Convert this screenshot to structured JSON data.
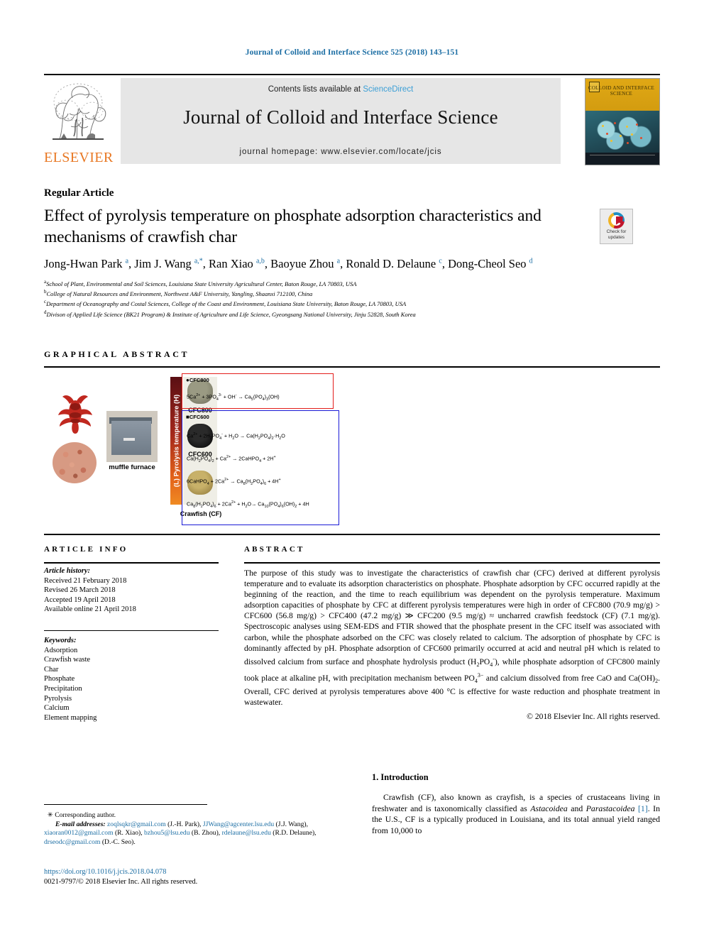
{
  "running_head": "Journal of Colloid and Interface Science 525 (2018) 143–151",
  "masthead": {
    "contents_prefix": "Contents lists available at ",
    "sciencedirect": "ScienceDirect",
    "journal_title": "Journal of Colloid and Interface Science",
    "homepage": "journal homepage: www.elsevier.com/locate/jcis",
    "publisher": "ELSEVIER",
    "cover_title": "COLLOID AND INTERFACE SCIENCE",
    "accent_blue": "#3c9fd6",
    "elsevier_orange": "#e87722"
  },
  "article": {
    "type": "Regular Article",
    "title": "Effect of pyrolysis temperature on phosphate adsorption characteristics and mechanisms of crawfish char",
    "crossmark_label": "Check for updates",
    "authors_html": "Jong-Hwan Park <sup>a</sup>, Jim J. Wang <sup>a,*</sup>, Ran Xiao <sup>a,b</sup>, Baoyue Zhou <sup>a</sup>, Ronald D. Delaune <sup>c</sup>, Dong-Cheol Seo <sup>d</sup>",
    "affiliations": [
      {
        "marker": "a",
        "text": "School of Plant, Environmental and Soil Sciences, Louisiana State University Agricultural Center, Baton Rouge, LA 70803, USA"
      },
      {
        "marker": "b",
        "text": "College of Natural Resources and Environment, Northwest A&F University, Yangling, Shaanxi 712100, China"
      },
      {
        "marker": "c",
        "text": "Department of Oceanography and Costal Sciences, College of the Coast and Environment, Louisiana State University, Baton Rouge, LA 70803, USA"
      },
      {
        "marker": "d",
        "text": "Divison of Applied Life Science (BK21 Program) & Institute of Agriculture and Life Science, Gyeongsang National University, Jinju 52828, South Korea"
      }
    ]
  },
  "graphical_abstract": {
    "heading": "GRAPHICAL ABSTRACT",
    "furnace_label": "muffle furnace",
    "temp_axis_label": "(L) Pyrolysis temperature (H)",
    "sample_labels": {
      "cfc800": "CFC800",
      "cfc600": "CFC600",
      "crawfish": "Crawfish (CF)"
    },
    "box_cfc800": {
      "header": "CFC800",
      "marker": "●",
      "border_color": "#e31d1a",
      "equations": [
        "5Ca<sup>2+</sup> + 3PO<sub>4</sub><sup>3-</sup> + OH<sup>-</sup> → Ca<sub>5</sub>(PO<sub>4</sub>)<sub>3</sub>(OH)"
      ]
    },
    "box_cfc600": {
      "header": "CFC600",
      "marker": "■",
      "border_color": "#1a1ad6",
      "equations": [
        "Ca<sup>2+</sup> + 2H<sub>2</sub>PO<sub>4</sub><sup>-</sup> + H<sub>2</sub>O → Ca(H<sub>2</sub>PO<sub>4</sub>)<sub>2</sub>·H<sub>2</sub>O",
        "Ca(H<sub>2</sub>PO<sub>4</sub>)<sub>2</sub> + Ca<sup>2+</sup> → 2CaHPO<sub>4</sub> + 2H<sup>+</sup>",
        "6CaHPO<sub>4</sub> + 2Ca<sup>2+</sup> → Ca<sub>8</sub>(H<sub>2</sub>PO<sub>4</sub>)<sub>6</sub> + 4H<sup>+</sup>",
        "Ca<sub>8</sub>(H<sub>2</sub>PO<sub>4</sub>)<sub>6</sub> + 2Ca<sup>2+</sup> + H<sub>2</sub>O→ Ca<sub>10</sub>(PO<sub>4</sub>)<sub>6</sub>(OH)<sub>2</sub> + 4H"
      ]
    }
  },
  "article_info": {
    "heading": "ARTICLE INFO",
    "history_label": "Article history:",
    "history": [
      "Received 21 February 2018",
      "Revised 26 March 2018",
      "Accepted 19 April 2018",
      "Available online 21 April 2018"
    ],
    "keywords_label": "Keywords:",
    "keywords": [
      "Adsorption",
      "Crawfish waste",
      "Char",
      "Phosphate",
      "Precipitation",
      "Pyrolysis",
      "Calcium",
      "Element mapping"
    ]
  },
  "abstract": {
    "heading": "ABSTRACT",
    "body_html": "The purpose of this study was to investigate the characteristics of crawfish char (CFC) derived at different pyrolysis temperature and to evaluate its adsorption characteristics on phosphate. Phosphate adsorption by CFC occurred rapidly at the beginning of the reaction, and the time to reach equilibrium was dependent on the pyrolysis temperature. Maximum adsorption capacities of phosphate by CFC at different pyrolysis temperatures were high in order of CFC800 (70.9 mg/g) &gt; CFC600 (56.8 mg/g) &gt; CFC400 (47.2 mg/g) &Gt; CFC200 (9.5 mg/g) ≈ uncharred crawfish feedstock (CF) (7.1 mg/g). Spectroscopic analyses using SEM-EDS and FTIR showed that the phosphate present in the CFC itself was associated with carbon, while the phosphate adsorbed on the CFC was closely related to calcium. The adsorption of phosphate by CFC is dominantly affected by pH. Phosphate adsorption of CFC600 primarily occurred at acid and neutral pH which is related to dissolved calcium from surface and phosphate hydrolysis product (H<sub>2</sub>PO<sub>4</sub><sup>-</sup>), while phosphate adsorption of CFC800 mainly took place at alkaline pH, with precipitation mechanism between PO<sub>4</sub><sup>3−</sup> and calcium dissolved from free CaO and Ca(OH)<sub>2</sub>. Overall, CFC derived at pyrolysis temperatures above 400 °C is effective for waste reduction and phosphate treatment in wastewater.",
    "copyright": "© 2018 Elsevier Inc. All rights reserved."
  },
  "footnote": {
    "corresponding": "Corresponding author.",
    "email_label": "E-mail addresses:",
    "emails_html": "<span class=\"lnk\">zoqlsqkr@gmail.com</span> (J.-H. Park), <span class=\"lnk\">JJWang@agcenter.lsu.edu</span> (J.J. Wang), <span class=\"lnk\">xiaoran0012@gmail.com</span> (R. Xiao), <span class=\"lnk\">bzhou5@lsu.edu</span> (B. Zhou), <span class=\"lnk\">rdelaune@lsu.edu</span> (R.D. Delaune), <span class=\"lnk\">drseodc@gmail.com</span> (D.-C. Seo).",
    "doi": "https://doi.org/10.1016/j.jcis.2018.04.078",
    "issn_line": "0021-9797/© 2018 Elsevier Inc. All rights reserved."
  },
  "introduction": {
    "heading": "1. Introduction",
    "body_html": "Crawfish (CF), also known as crayfish, is a species of crustaceans living in freshwater and is taxonomically classified as <span class=\"it\">Astacoidea</span> and <span class=\"it\">Parastacoidea</span> <span class=\"ref\">[1]</span>. In the U.S., CF is a typically produced in Louisiana, and its total annual yield ranged from 10,000 to"
  }
}
